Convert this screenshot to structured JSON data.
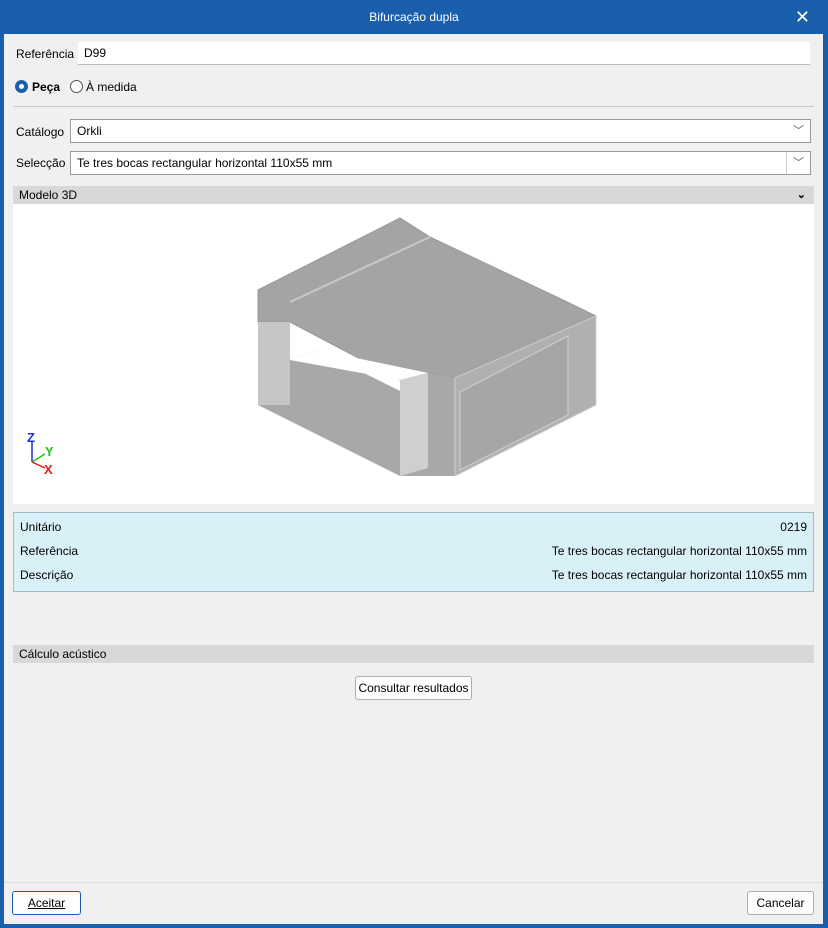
{
  "window": {
    "title": "Bifurcação dupla"
  },
  "form": {
    "referencia_label": "Referência",
    "referencia_value": "D99",
    "radio_peca": "Peça",
    "radio_medida": "À medida",
    "selected": "Peça",
    "catalogo_label": "Catálogo",
    "catalogo_value": "Orkli",
    "seleccao_label": "Selecção",
    "seleccao_value": "Te tres bocas rectangular horizontal 110x55 mm"
  },
  "model": {
    "header": "Modelo 3D",
    "axes": {
      "z": "Z",
      "y": "Y",
      "x": "X"
    },
    "colors": {
      "z": "#1a2fd8",
      "y": "#22c022",
      "x": "#e01818"
    }
  },
  "info": {
    "rows": [
      {
        "label": "Unitário",
        "value": "0219"
      },
      {
        "label": "Referência",
        "value": "Te tres bocas rectangular horizontal 110x55 mm"
      },
      {
        "label": "Descrição",
        "value": "Te tres bocas rectangular horizontal 110x55 mm"
      }
    ]
  },
  "acoustic": {
    "header": "Cálculo acústico",
    "button": "Consultar resultados"
  },
  "footer": {
    "accept": "Aceitar",
    "cancel": "Cancelar"
  }
}
